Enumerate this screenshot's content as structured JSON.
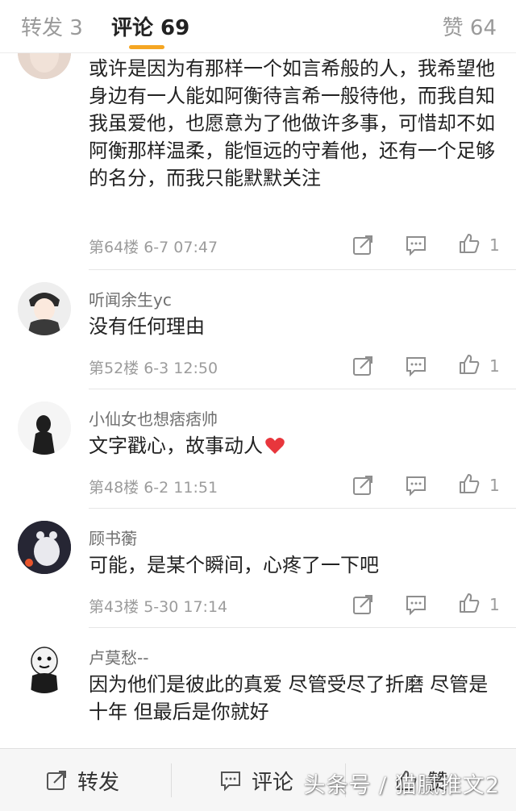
{
  "tabs": {
    "repost": "转发 3",
    "comments": "评论 69",
    "likes": "赞 64"
  },
  "comments": [
    {
      "text": "或许是因为有那样一个如言希般的人，我希望他身边有一人能如阿衡待言希一般待他，而我自知我虽爱他，也愿意为了他做许多事，可惜却不如阿衡那样温柔，能恒远的守着他，还有一个足够的名分，而我只能默默关注",
      "meta": "第64楼  6-7 07:47",
      "likes": "1"
    },
    {
      "user": "听闻余生yc",
      "text": "没有任何理由",
      "meta": "第52楼  6-3 12:50",
      "likes": "1"
    },
    {
      "user": "小仙女也想痞痞帅",
      "text": "文字戳心，故事动人",
      "meta": "第48楼  6-2 11:51",
      "likes": "1"
    },
    {
      "user": "顾书蘅",
      "text": "可能，是某个瞬间，心疼了一下吧",
      "meta": "第43楼  5-30 17:14",
      "likes": "1"
    },
    {
      "user": "卢莫愁--",
      "text": "因为他们是彼此的真爱 尽管受尽了折磨 尽管是十年 但最后是你就好"
    }
  ],
  "bottom": {
    "repost": "转发",
    "comment": "评论",
    "like": "赞"
  },
  "watermark": "头条号 / 猫腻推文2",
  "colors": {
    "accent": "#f5a623",
    "heart": "#e8363c",
    "icon": "#8e8e8e"
  }
}
